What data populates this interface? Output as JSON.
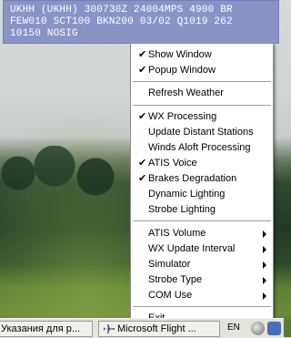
{
  "weather": {
    "line1": "UKHH (UKHH) 300730Z 24004MPS 4900 BR",
    "line2": "FEW010 SCT100 BKN200 03/02 Q1019 262",
    "line3": "10150 NOSIG"
  },
  "menu": {
    "items": [
      {
        "label": "Show Window",
        "checked": "✔"
      },
      {
        "label": "Popup Window",
        "checked": "✔"
      },
      {
        "label": "Refresh Weather",
        "checked": ""
      },
      {
        "label": "WX Processing",
        "checked": "✔"
      },
      {
        "label": "Update Distant Stations",
        "checked": ""
      },
      {
        "label": "Winds Aloft Processing",
        "checked": ""
      },
      {
        "label": "ATIS Voice",
        "checked": "✔"
      },
      {
        "label": "Brakes Degradation",
        "checked": "✔"
      },
      {
        "label": "Dynamic Lighting",
        "checked": ""
      },
      {
        "label": "Strobe Lighting",
        "checked": ""
      },
      {
        "label": "ATIS Volume",
        "checked": ""
      },
      {
        "label": "WX Update Interval",
        "checked": ""
      },
      {
        "label": "Simulator",
        "checked": ""
      },
      {
        "label": "Strobe Type",
        "checked": ""
      },
      {
        "label": "COM Use",
        "checked": ""
      },
      {
        "label": "Exit",
        "checked": ""
      }
    ]
  },
  "taskbar": {
    "btn1": "Указания для р...",
    "btn2": "Microsoft Flight ...",
    "lang": "EN",
    "icons": [
      "plane-icon",
      "tray-clock-icon",
      "tray-app-icon"
    ]
  },
  "colors": {
    "overlay": "#8a93c6",
    "menu_bg": "#ffffff",
    "taskbar_bg": "#e4e3dc"
  }
}
